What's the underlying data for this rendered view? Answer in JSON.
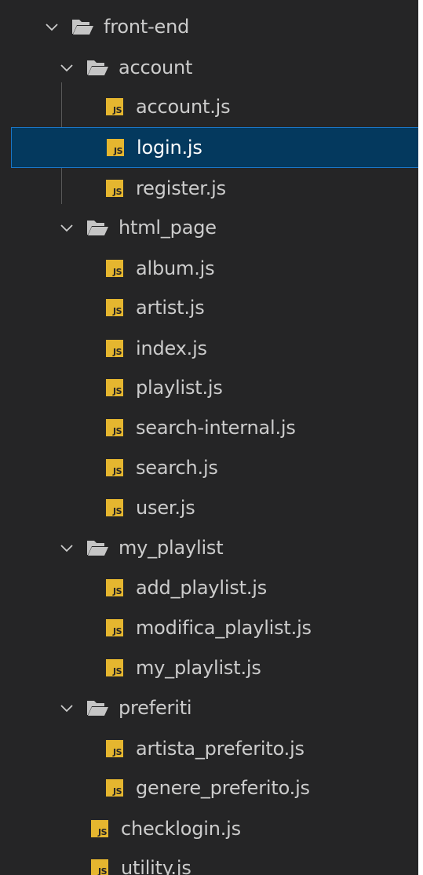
{
  "explorer": {
    "root": {
      "label": "front-end",
      "expanded": true
    },
    "folders": {
      "account": {
        "label": "account",
        "expanded": true
      },
      "html_page": {
        "label": "html_page",
        "expanded": true
      },
      "my_playlist": {
        "label": "my_playlist",
        "expanded": true
      },
      "preferiti": {
        "label": "preferiti",
        "expanded": true
      }
    },
    "files": {
      "account_js": "account.js",
      "login_js": "login.js",
      "register_js": "register.js",
      "album_js": "album.js",
      "artist_js": "artist.js",
      "index_js": "index.js",
      "playlist_js": "playlist.js",
      "search_internal_js": "search-internal.js",
      "search_js": "search.js",
      "user_js": "user.js",
      "add_playlist_js": "add_playlist.js",
      "modifica_playlist_js": "modifica_playlist.js",
      "my_playlist_js": "my_playlist.js",
      "artista_preferito_js": "artista_preferito.js",
      "genere_preferito_js": "genere_preferito.js",
      "checklogin_js": "checklogin.js",
      "utility_js": "utility.js"
    },
    "selected_file": "login.js",
    "file_icon_text": "JS",
    "colors": {
      "background": "#252526",
      "selection": "#04395e",
      "selection_border": "#1a76c7",
      "js_badge": "#e5b62f",
      "text": "#cccccc"
    }
  }
}
